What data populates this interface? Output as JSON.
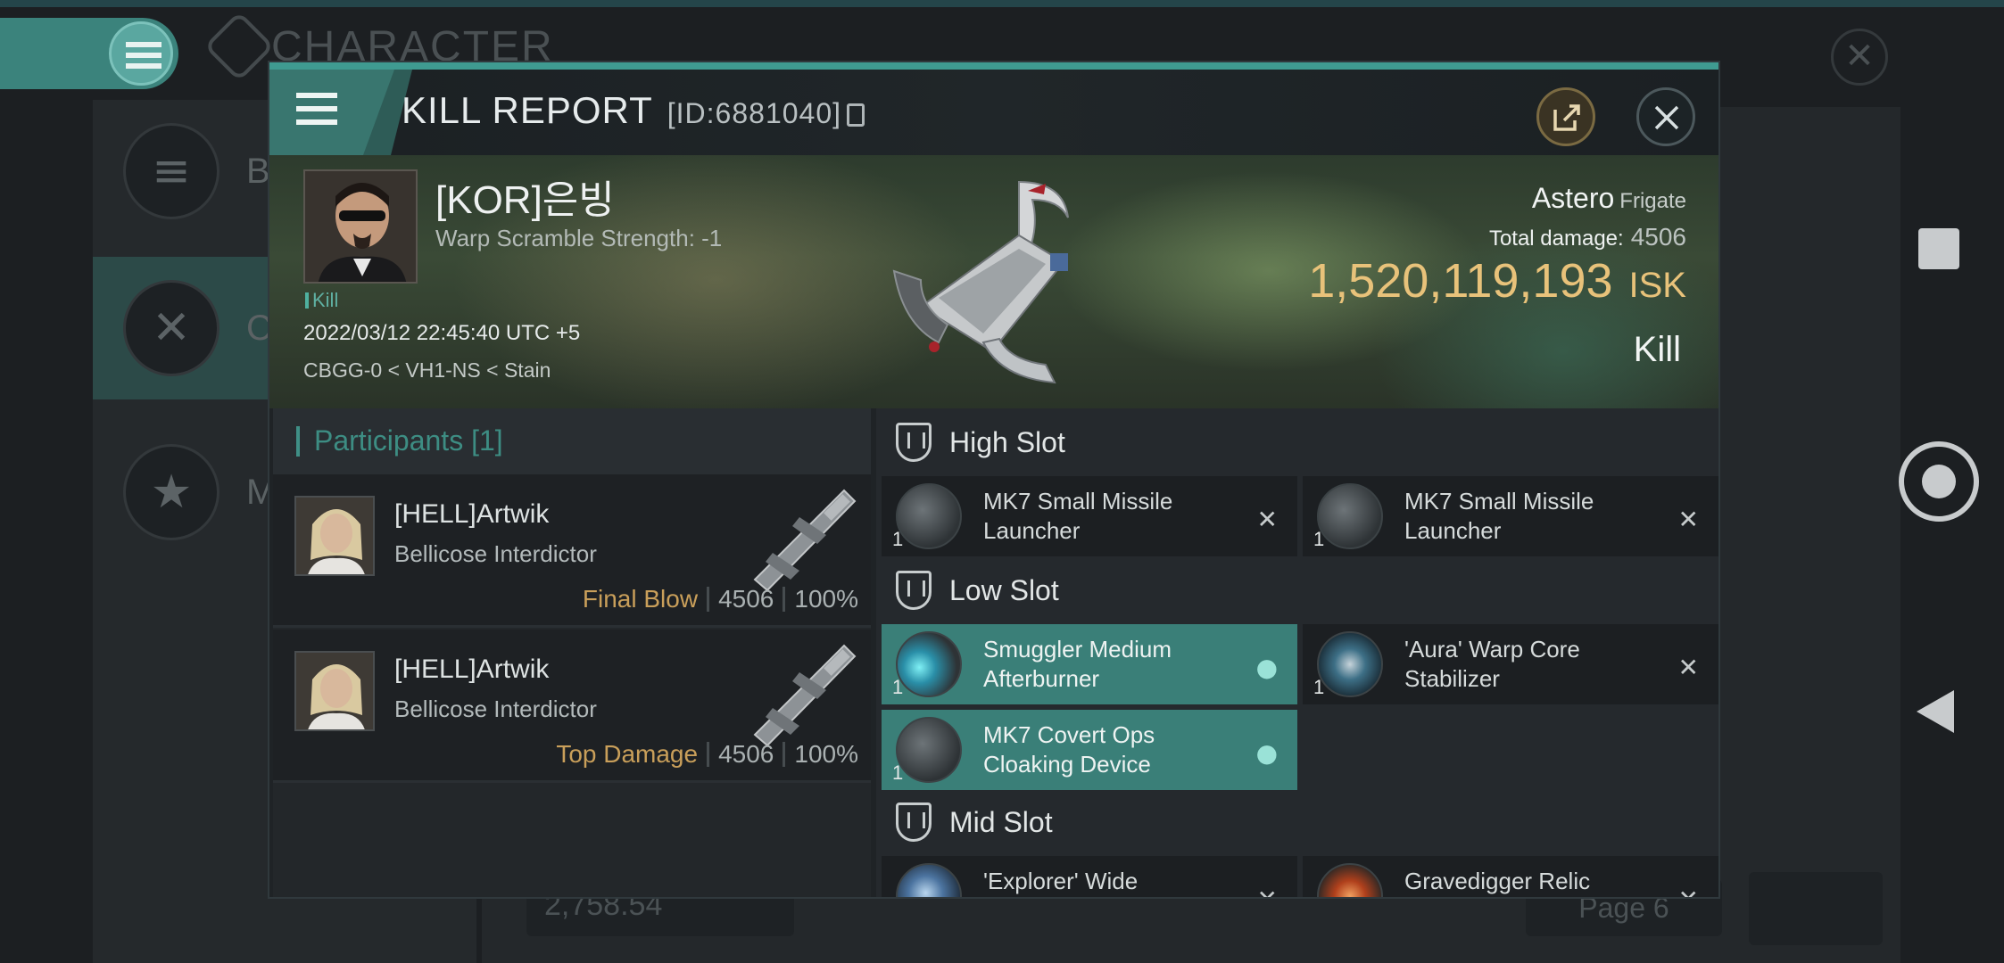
{
  "background": {
    "title": "CHARACTER",
    "sidebar": [
      {
        "label": "Bio",
        "icon": "list-icon"
      },
      {
        "label": "Co",
        "icon": "swords-icon",
        "active": true
      },
      {
        "label": "Me",
        "icon": "star-icon"
      }
    ],
    "isk_balance": "2,758.54",
    "page": "Page 6"
  },
  "modal": {
    "title": "KILL REPORT",
    "id": "[ID:6881040]"
  },
  "victim": {
    "name": "[KOR]은빙",
    "warp_scramble": "Warp Scramble Strength: -1",
    "tag": "Kill",
    "datetime": "2022/03/12 22:45:40 UTC +5",
    "location": "CBGG-0 < VH1-NS < Stain",
    "ship": "Astero",
    "ship_class": "Frigate",
    "total_damage_label": "Total damage:",
    "total_damage": "4506",
    "isk": "1,520,119,193",
    "isk_unit": "ISK",
    "result": "Kill"
  },
  "participants": {
    "header": "Participants [1]",
    "rows": [
      {
        "name": "[HELL]Artwik",
        "ship": "Bellicose Interdictor",
        "role": "Final Blow",
        "damage": "4506",
        "percent": "100%"
      },
      {
        "name": "[HELL]Artwik",
        "ship": "Bellicose Interdictor",
        "role": "Top Damage",
        "damage": "4506",
        "percent": "100%"
      }
    ]
  },
  "fittings": {
    "high_slot": {
      "label": "High Slot",
      "items": [
        {
          "name": "MK7 Small Missile Launcher",
          "qty": "1",
          "status": "destroyed"
        },
        {
          "name": "MK7 Small Missile Launcher",
          "qty": "1",
          "status": "destroyed"
        }
      ]
    },
    "low_slot": {
      "label": "Low Slot",
      "items": [
        {
          "name": "Smuggler Medium Afterburner",
          "qty": "1",
          "status": "dropped"
        },
        {
          "name": "'Aura' Warp Core Stabilizer",
          "qty": "1",
          "status": "destroyed"
        },
        {
          "name": "MK7 Covert Ops Cloaking Device",
          "qty": "1",
          "status": "dropped"
        }
      ]
    },
    "mid_slot": {
      "label": "Mid Slot",
      "items": [
        {
          "name": "'Explorer' Wide",
          "qty": "",
          "status": "destroyed"
        },
        {
          "name": "Gravedigger Relic",
          "qty": "",
          "status": "destroyed"
        }
      ]
    }
  },
  "colors": {
    "accent": "#3f9b91",
    "isk": "#e8c27a",
    "role": "#c99f5a",
    "dropped_bg": "#3a7f78"
  }
}
